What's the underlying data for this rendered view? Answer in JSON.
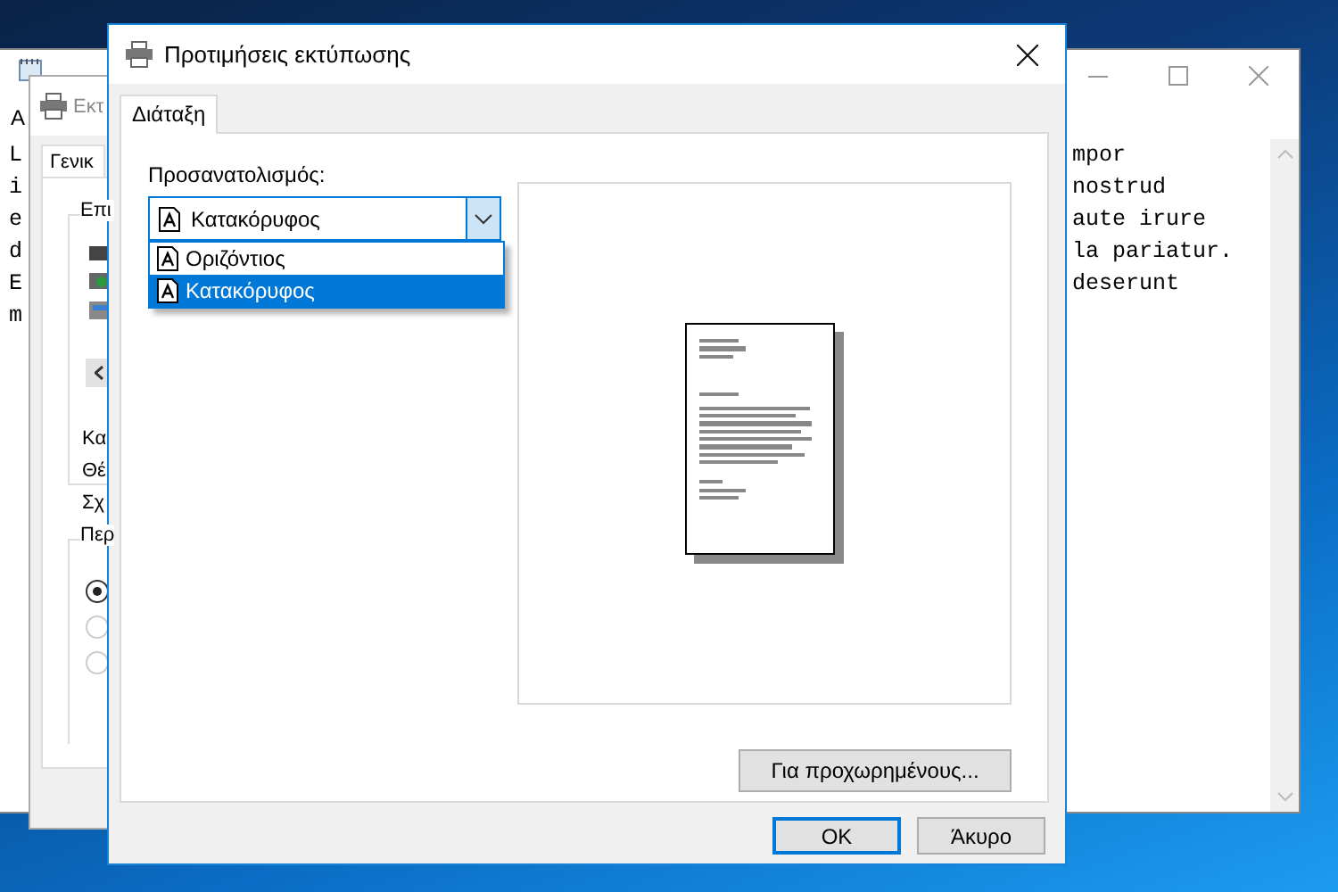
{
  "notepad_window": {
    "menu": "Α",
    "text_left": [
      "L",
      "i",
      "e",
      "d",
      "E",
      "m"
    ],
    "text_right": [
      "mpor",
      "nostrud",
      "aute irure",
      "la pariatur.",
      "deserunt"
    ]
  },
  "print_window": {
    "title": "Εκτ",
    "tab": "Γενικ",
    "group_1": "Επι",
    "labels": [
      "Κα",
      "Θέ",
      "Σχ"
    ],
    "group_2": "Περ",
    "radios": [
      {
        "selected": true,
        "disabled": false
      },
      {
        "selected": false,
        "disabled": true
      },
      {
        "selected": false,
        "disabled": true
      }
    ]
  },
  "preferences_dialog": {
    "title": "Προτιμήσεις εκτύπωσης",
    "tabs": [
      {
        "label": "Διάταξη",
        "selected": true
      }
    ],
    "orientation_label": "Προσανατολισμός:",
    "orientation_value": "Κατακόρυφος",
    "dropdown_expanded": true,
    "options": [
      {
        "label": "Οριζόντιος",
        "selected": false
      },
      {
        "label": "Κατακόρυφος",
        "selected": true
      }
    ],
    "advanced_button": "Για προχωρημένους...",
    "buttons": [
      {
        "label": "OK",
        "default": true
      },
      {
        "label": "Άκυρο",
        "default": false
      }
    ]
  }
}
